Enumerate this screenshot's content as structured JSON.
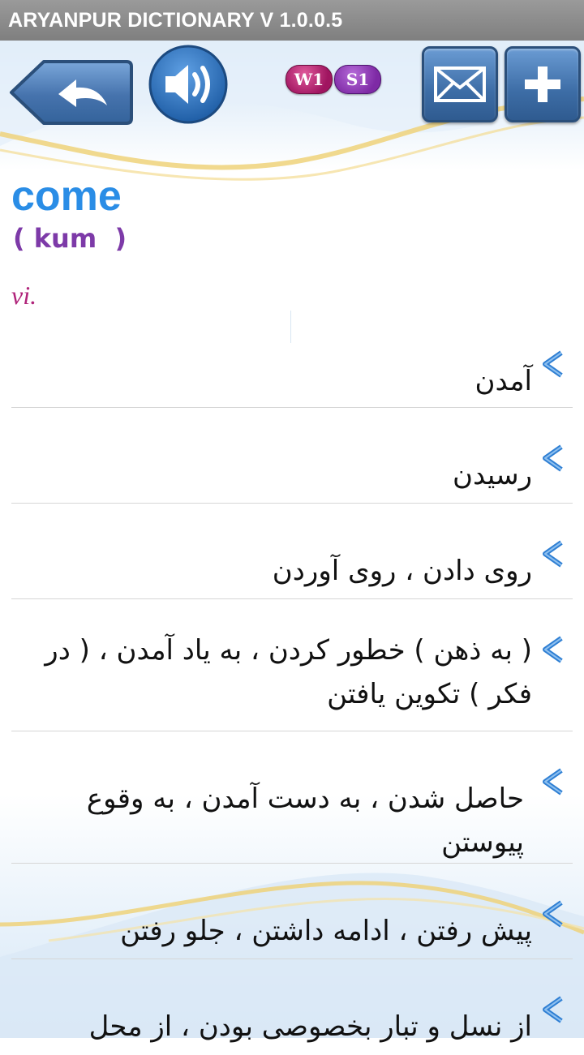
{
  "window": {
    "title": "ARYANPUR DICTIONARY V 1.0.0.5"
  },
  "toolbar": {
    "badges": [
      "W1",
      "S1"
    ],
    "icons": [
      "back-arrow-icon",
      "speaker-icon",
      "mail-icon",
      "plus-icon"
    ]
  },
  "entry": {
    "word": "come",
    "pronunciation": "( kum  )",
    "part_of_speech": "vi.",
    "definitions": [
      "آمدن",
      "رسیدن",
      "روی دادن ، روی آوردن",
      "( به ذهن ) خطور کردن ، به یاد آمدن ، ( در فکر ) تکوین یافتن",
      "حاصل شدن ، به دست آمدن ، به وقوع پیوستن",
      "پیش رفتن ، ادامه داشتن ، جلو رفتن",
      "از نسل و تبار بخصوصی بودن ، از محل"
    ]
  },
  "colors": {
    "titlebar": "#8c8c8c",
    "word": "#2a8de6",
    "pronunciation": "#7d3aa8",
    "part_of_speech": "#b0247a",
    "chevron": "#2f7fd3",
    "button": "#3d6da6"
  }
}
